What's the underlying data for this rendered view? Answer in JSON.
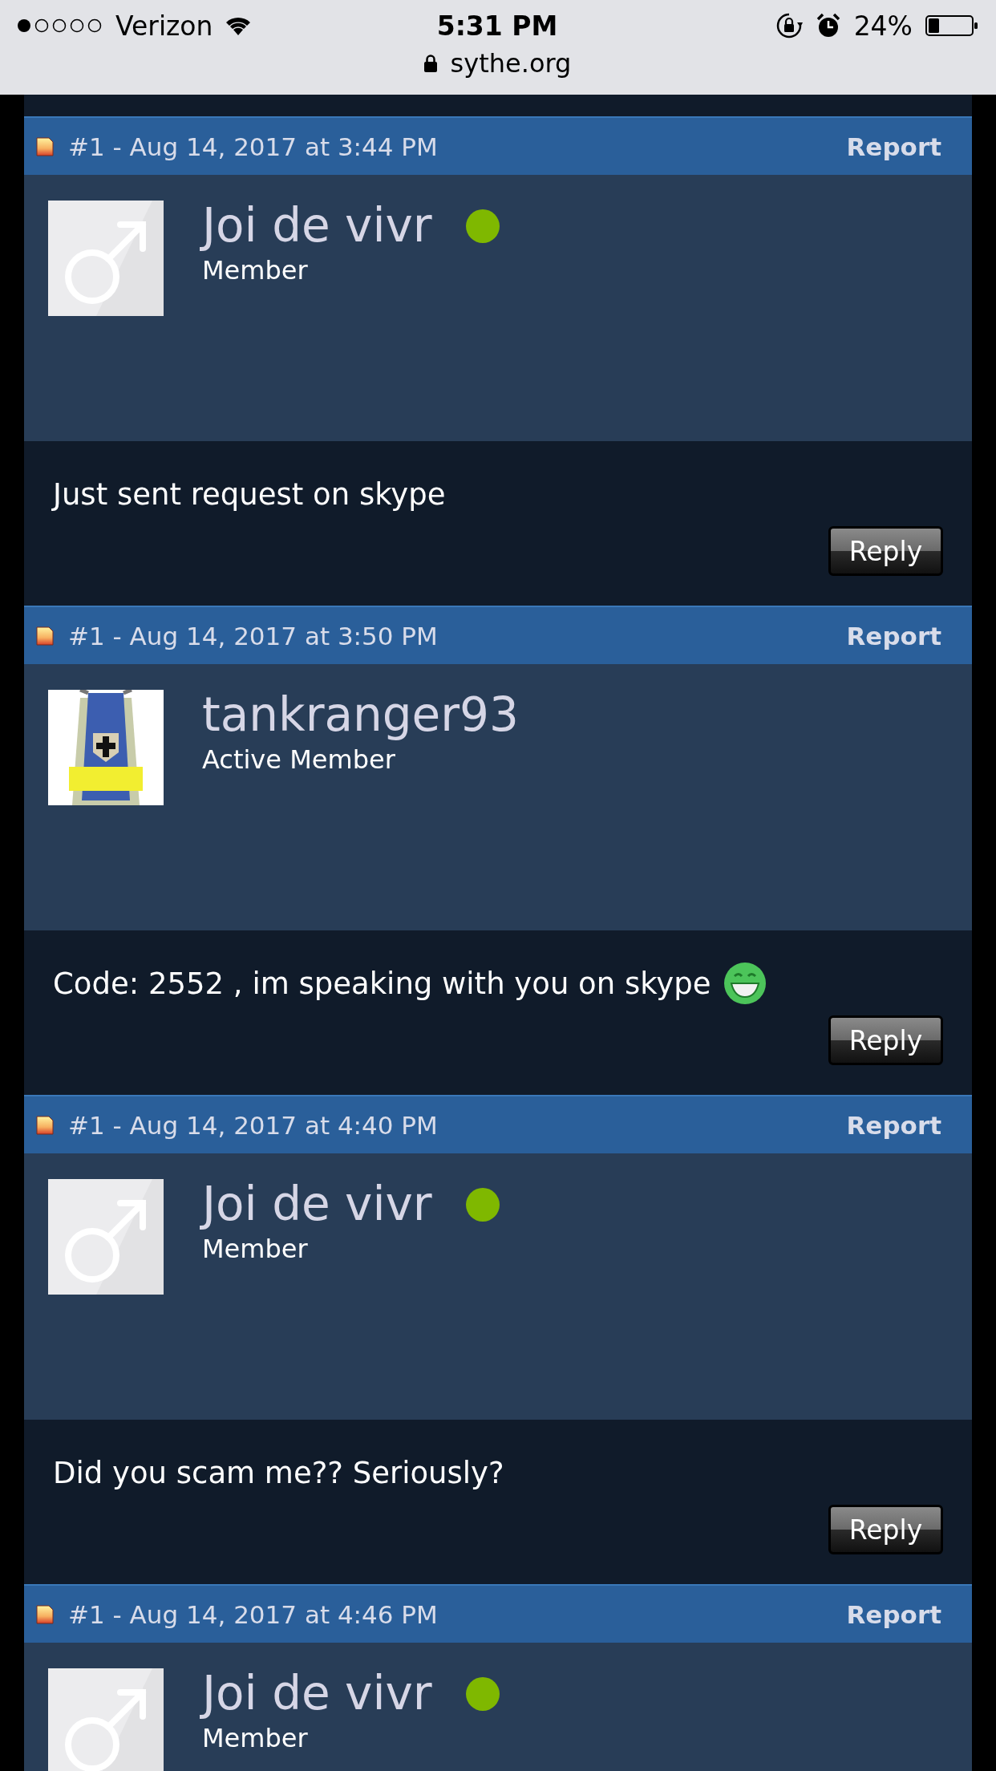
{
  "status_bar": {
    "carrier": "Verizon",
    "time": "5:31 PM",
    "battery": "24%"
  },
  "address_bar": {
    "url": "sythe.org"
  },
  "posts": [
    {
      "header": "#1 - Aug 14, 2017 at 3:44 PM",
      "report": "Report",
      "author": "Joi de vivr",
      "role": "Member",
      "online": true,
      "avatar": {
        "kind": "male"
      },
      "message": "Just sent request on skype",
      "smiley": false,
      "reply": "Reply"
    },
    {
      "header": "#1 - Aug 14, 2017 at 3:50 PM",
      "report": "Report",
      "author": "tankranger93",
      "role": "Active Member",
      "online": false,
      "message": "Code: 2552 , im speaking with you on skype",
      "smiley": true,
      "reply": "Reply"
    },
    {
      "header": "#1 - Aug 14, 2017 at 4:40 PM",
      "report": "Report",
      "author": "Joi de vivr",
      "role": "Member",
      "online": true,
      "avatar": {
        "kind": "male"
      },
      "message": "Did you scam me?? Seriously?",
      "smiley": false,
      "reply": "Reply"
    },
    {
      "header": "#1 - Aug 14, 2017 at 4:46 PM",
      "report": "Report",
      "author": "Joi de vivr",
      "role": "Member",
      "online": true,
      "avatar": {
        "kind": "male"
      }
    }
  ]
}
